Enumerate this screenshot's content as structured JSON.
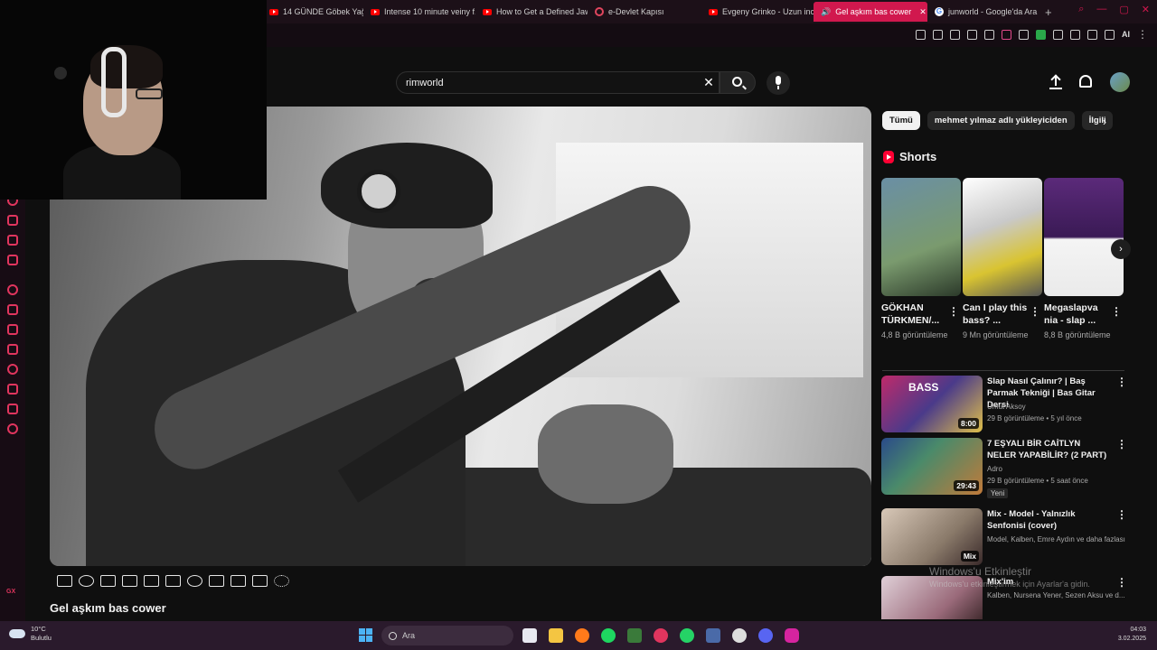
{
  "browser": {
    "tabs": [
      {
        "label": "14 GÜNDE Göbek Yağını...",
        "icon": "youtube-icon"
      },
      {
        "label": "Intense 10 minute veiny f...",
        "icon": "youtube-icon"
      },
      {
        "label": "How to Get a Defined Jaw...",
        "icon": "youtube-icon"
      },
      {
        "label": "e-Devlet Kapısı",
        "icon": "edevlet-icon"
      },
      {
        "label": "Evgeny Grinko - Uzun inc...",
        "icon": "youtube-icon"
      },
      {
        "label": "Gel aşkım bas cower",
        "icon": "youtube-icon",
        "active": true
      },
      {
        "label": "junworld - Google'da Ara",
        "icon": "google-icon"
      }
    ],
    "new_tab": "+",
    "extensions_ai": "AI",
    "accent_color": "#d1184e"
  },
  "youtube": {
    "search": {
      "query": "rimworld"
    },
    "clear_glyph": "✕"
  },
  "video": {
    "title": "Gel aşkım bas cower",
    "controls": [
      "loop-icon",
      "broadcast-icon",
      "screen-record-icon",
      "clip-icon",
      "theater-icon",
      "miniplayer-icon",
      "speed-icon",
      "add-icon",
      "screenshot-icon",
      "subtitles-icon",
      "settings-icon"
    ]
  },
  "chips": [
    "Tümü",
    "mehmet yılmaz adlı yükleyiciden",
    "İlgili"
  ],
  "shorts": {
    "title": "Shorts",
    "items": [
      {
        "title": "GÖKHAN TÜRKMEN/...",
        "views": "4,8 B görüntüleme"
      },
      {
        "title": "Can I play this bass? ...",
        "views": "9 Mn görüntüleme"
      },
      {
        "title": "Megaslapva nia - slap ...",
        "views": "8,8 B görüntüleme"
      }
    ]
  },
  "recommendations": [
    {
      "title": "Slap Nasıl Çalınır? | Baş Parmak Tekniği | Bas Gitar Dersi",
      "channel": "Umut Aksoy",
      "meta": "29 B görüntüleme • 5 yıl önce",
      "duration": "8:00",
      "thumb_text": "BASS"
    },
    {
      "title": "7 EŞYALI BİR CAİTLYN NELER YAPABİLİR? (2 PART)",
      "channel": "Adro",
      "meta": "29 B görüntüleme • 5 saat önce",
      "duration": "29:43",
      "badge": "Yeni"
    },
    {
      "title": "Mix - Model - Yalnızlık Senfonisi (cover)",
      "channel": "Model, Kalben, Emre Aydın ve daha fazlası",
      "duration": "Mix"
    },
    {
      "title": "Mix'im",
      "channel": "Kalben, Nursena Yener, Sezen Aksu ve d..."
    }
  ],
  "windows_activation": {
    "line1": "Windows'u Etkinleştir",
    "line2": "Windows'u etkinleştirmek için Ayarlar'a gidin."
  },
  "taskbar": {
    "weather_temp": "10°C",
    "weather_desc": "Bulutlu",
    "search_label": "Ara",
    "time": "04:03",
    "date": "3.02.2025"
  },
  "sidebar_gx": "GX"
}
